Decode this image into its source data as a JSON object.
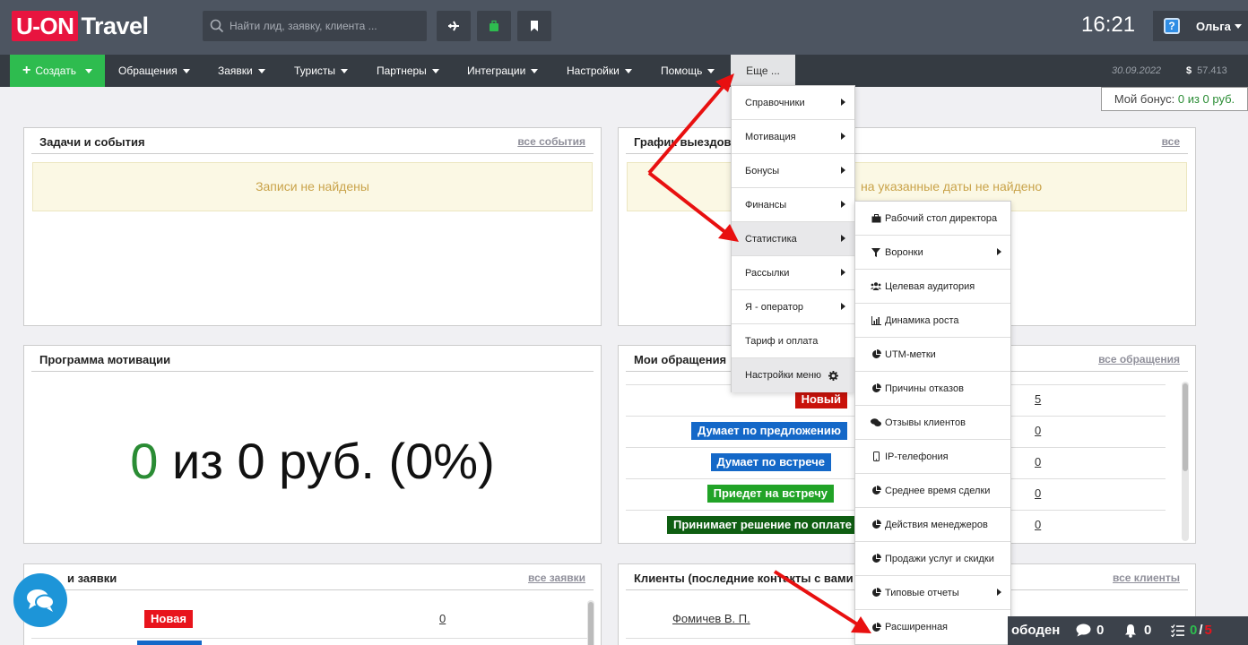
{
  "header": {
    "logo_box": "U-ON",
    "logo_text": "Travel",
    "search_placeholder": "Найти лид, заявку, клиента ...",
    "clock": "16:21",
    "help_glyph": "?",
    "user_name": "Ольга"
  },
  "nav": {
    "create": "Создать",
    "items": [
      "Обращения",
      "Заявки",
      "Туристы",
      "Партнеры",
      "Интеграции",
      "Настройки",
      "Помощь"
    ],
    "more": "Еще ...",
    "date": "30.09.2022",
    "currency": "$",
    "balance": "57.413"
  },
  "bonus": {
    "label": "Мой бонус:",
    "value": "0 из 0 руб."
  },
  "panels": {
    "tasks": {
      "title": "Задачи и события",
      "link": "все события",
      "empty": "Записи не найдены"
    },
    "schedule": {
      "title": "График выездов",
      "link": "все",
      "empty": "на указанные даты не найдено"
    },
    "motivation": {
      "title": "Программа мотивации",
      "zero": "0",
      "rest": "из 0 руб. (0%)"
    },
    "appeals": {
      "title": "Мои обращения",
      "link": "все обращения",
      "rows": [
        {
          "label": "Новый",
          "color": "#c9120a",
          "count": "5"
        },
        {
          "label": "Думает по предложению",
          "color": "#1468c8",
          "count": "0"
        },
        {
          "label": "Думает по встрече",
          "color": "#1468c8",
          "count": "0"
        },
        {
          "label": "Приедет на встречу",
          "color": "#21a327",
          "count": "0"
        },
        {
          "label": "Принимает решение по оплате",
          "color": "#0f5e12",
          "count": "0"
        }
      ]
    },
    "requests": {
      "title": "и заявки",
      "link": "все заявки",
      "row_label": "Новая",
      "row_count": "0"
    },
    "clients": {
      "title": "Клиенты (последние контакты с вами",
      "link": "все клиенты",
      "first_client": "Фомичев В. П."
    }
  },
  "menu_more": {
    "items": [
      {
        "label": "Справочники",
        "sub": true
      },
      {
        "label": "Мотивация",
        "sub": true
      },
      {
        "label": "Бонусы",
        "sub": true
      },
      {
        "label": "Финансы",
        "sub": true
      },
      {
        "label": "Статистика",
        "sub": true
      },
      {
        "label": "Рассылки",
        "sub": true
      },
      {
        "label": "Я - оператор",
        "sub": true
      },
      {
        "label": "Тариф и оплата",
        "sub": false
      },
      {
        "label": "Настройки меню",
        "sub": false
      }
    ]
  },
  "menu_stats": {
    "items": [
      {
        "label": "Рабочий стол директора",
        "icon": "briefcase-icon",
        "sub": false
      },
      {
        "label": "Воронки",
        "icon": "funnel-icon",
        "sub": true
      },
      {
        "label": "Целевая аудитория",
        "icon": "users-icon",
        "sub": false
      },
      {
        "label": "Динамика роста",
        "icon": "bar-chart-icon",
        "sub": false
      },
      {
        "label": "UTM-метки",
        "icon": "pie-chart-icon",
        "sub": false
      },
      {
        "label": "Причины отказов",
        "icon": "pie-chart-icon",
        "sub": false
      },
      {
        "label": "Отзывы клиентов",
        "icon": "comments-icon",
        "sub": false
      },
      {
        "label": "IP-телефония",
        "icon": "mobile-icon",
        "sub": false
      },
      {
        "label": "Среднее время сделки",
        "icon": "pie-chart-icon",
        "sub": false
      },
      {
        "label": "Действия менеджеров",
        "icon": "pie-chart-icon",
        "sub": false
      },
      {
        "label": "Продажи услуг и скидки",
        "icon": "pie-chart-icon",
        "sub": false
      },
      {
        "label": "Типовые отчеты",
        "icon": "pie-chart-icon",
        "sub": true
      },
      {
        "label": "Расширенная",
        "icon": "pie-chart-icon",
        "sub": false
      }
    ]
  },
  "bottombar": {
    "status": "ободен",
    "messages": "0",
    "notifications": "0",
    "tasks_done": "0",
    "tasks_sep": "/",
    "tasks_total": "5"
  },
  "colors": {
    "accent_green": "#2ebc4f",
    "logo_red": "#e8143f",
    "arrow_red": "#e81010"
  }
}
